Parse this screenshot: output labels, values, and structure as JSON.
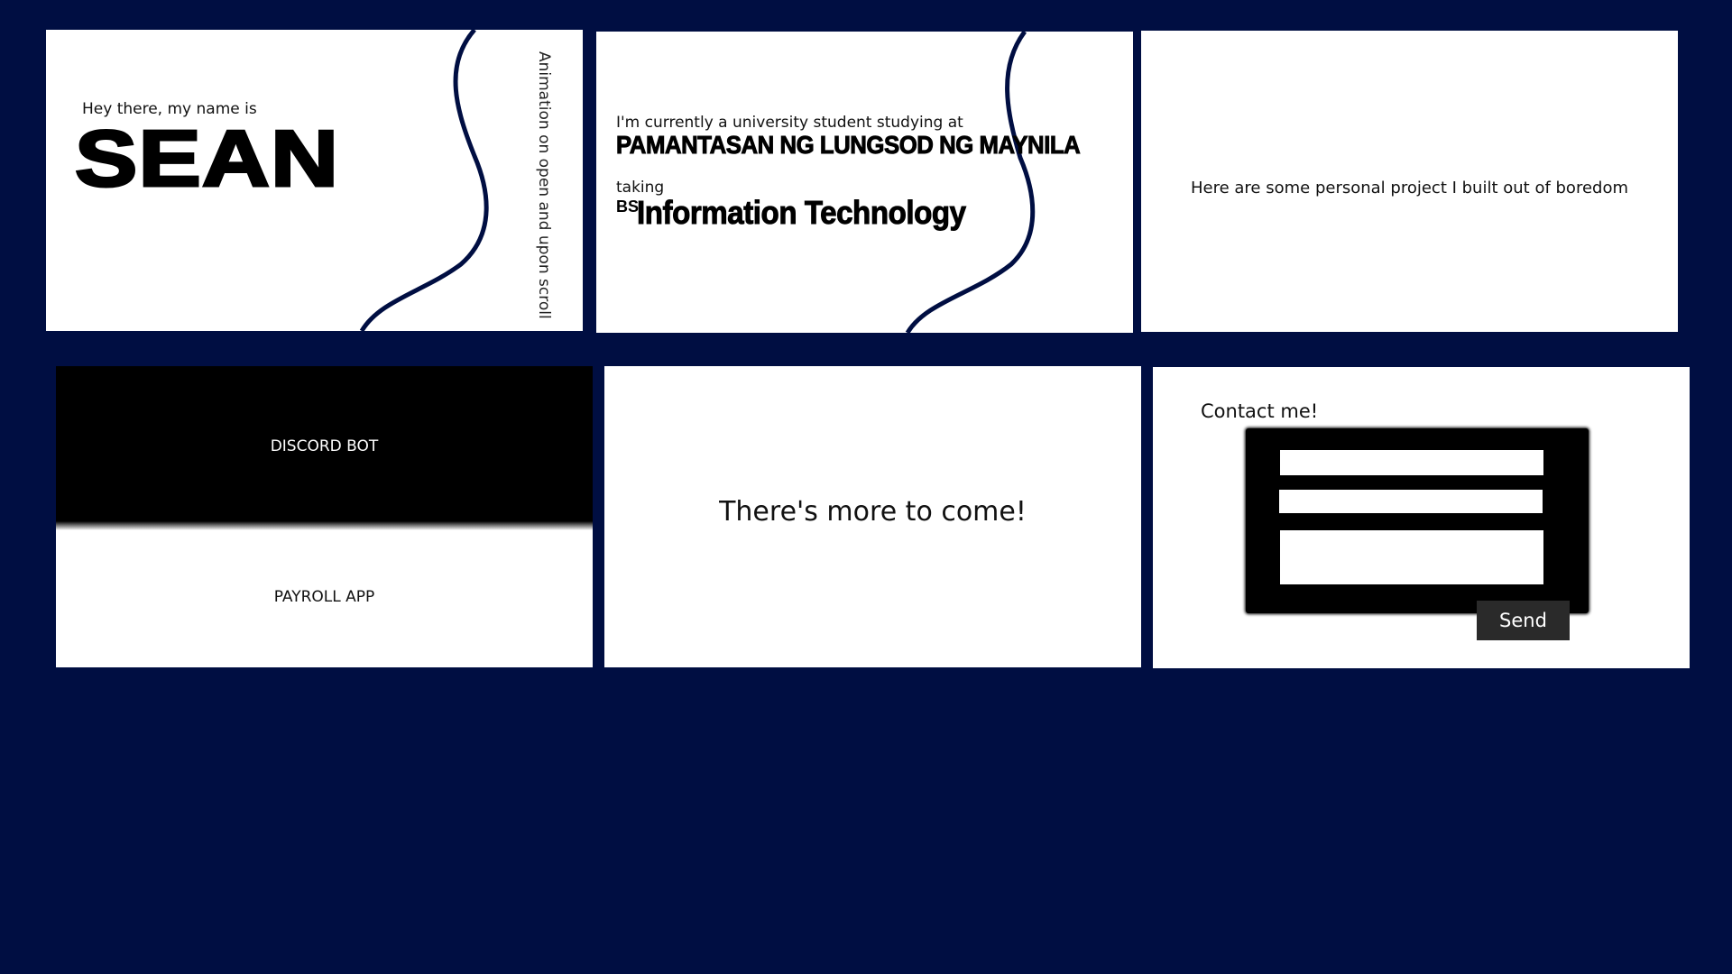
{
  "colors": {
    "background": "#000e42",
    "card": "#ffffff",
    "wave_stroke": "#000e42",
    "black_panel": "#000000",
    "send_button": "#2a2a2a"
  },
  "intro_card": {
    "greeting": "Hey there, my name is",
    "name": "SEAN",
    "animation_note": "Animation on open and upon scroll"
  },
  "study_card": {
    "intro": "I'm currently a university student studying at",
    "school": "PAMANTASAN NG LUNGSOD NG MAYNILA",
    "taking": "taking",
    "degree_prefix": "BS",
    "degree": "Information Technology"
  },
  "projects_card": {
    "text": "Here are some personal project I built out of boredom"
  },
  "project_list": {
    "items": [
      "DISCORD BOT",
      "PAYROLL APP"
    ]
  },
  "more_card": {
    "text": "There's more to come!"
  },
  "contact_card": {
    "title": "Contact me!",
    "name_value": "",
    "email_value": "",
    "message_value": "",
    "send_label": "Send"
  }
}
